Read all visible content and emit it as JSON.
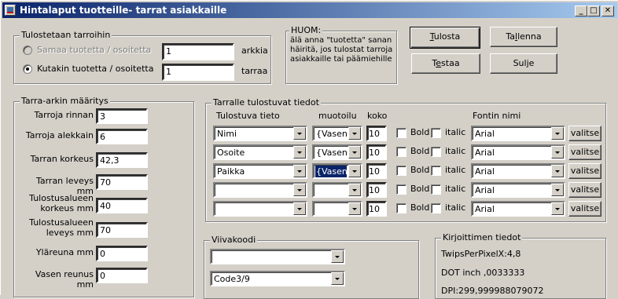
{
  "window": {
    "title": "Hintalaput tuotteille- tarrat asiakkaille",
    "min": "_",
    "max": "□",
    "close": "✕"
  },
  "print_group": {
    "label": "Tulostetaan tarroihin",
    "radio1": "Samaa tuotetta / osoitetta",
    "radio1_selected": false,
    "radio1_disabled": true,
    "radio2": "Kutakin tuotetta / osoitetta",
    "radio2_selected": true,
    "sheets_value": "1",
    "sheets_unit": "arkkia",
    "labels_value": "1",
    "labels_unit": "tarraa"
  },
  "note": {
    "label": "HUOM:",
    "text": "älä anna \"tuotetta\" sanan häiritä, jos tulostat tarroja asiakkaille tai päämiehille"
  },
  "buttons": {
    "print": "Tulosta",
    "print_key": "T",
    "print_rest": "ulosta",
    "save": "Tallenna",
    "save_pre": "Ta",
    "save_key": "l",
    "save_rest": "lenna",
    "test": "Testaa",
    "test_pre": "T",
    "test_key": "e",
    "test_rest": "staa",
    "close": "Sulje",
    "close_pre": "Sul",
    "close_key": "j",
    "close_rest": "e"
  },
  "label_def": {
    "label": "Tarra-arkin määritys",
    "fields": [
      {
        "label": "Tarroja rinnan",
        "value": "3"
      },
      {
        "label": "Tarroja alekkain",
        "value": "6"
      },
      {
        "label": "Tarran korkeus",
        "value": "42,3"
      },
      {
        "label": "Tarran leveys mm",
        "value": "70"
      },
      {
        "label": "Tulostusalueen korkeus mm",
        "value": "40"
      },
      {
        "label": "Tulostusalueen leveys mm",
        "value": "70"
      },
      {
        "label": "Yläreuna mm",
        "value": "0"
      },
      {
        "label": "Vasen reunus mm",
        "value": "0"
      }
    ]
  },
  "fields_group": {
    "label": "Tarralle tulostuvat tiedot",
    "headers": {
      "field": "Tulostuva tieto",
      "format": "muotoilu",
      "size": "koko",
      "font": "Fontin nimi"
    },
    "bold": "Bold",
    "italic": "italic",
    "choose": "valitse",
    "rows": [
      {
        "field": "Nimi",
        "format": "{Vasen",
        "size": "10",
        "font": "Arial",
        "format_selected": false
      },
      {
        "field": "Osoite",
        "format": "{Vasen",
        "size": "10",
        "font": "Arial",
        "format_selected": false
      },
      {
        "field": "Paikka",
        "format": "{Vasen",
        "size": "10",
        "font": "Arial",
        "format_selected": true
      },
      {
        "field": "",
        "format": "",
        "size": "10",
        "font": "Arial",
        "format_selected": false
      },
      {
        "field": "",
        "format": "",
        "size": "10",
        "font": "Arial",
        "format_selected": false
      }
    ]
  },
  "barcode": {
    "label": "Viivakoodi",
    "field": "",
    "type": "Code3/9"
  },
  "printer": {
    "label": "Kirjoittimen tiedot",
    "twips": "TwipsPerPixelX:4,8",
    "dot": "DOT inch ,0033333",
    "dpi": "DPI:299,999988079072"
  },
  "colors": {
    "title_start": "#0a246a",
    "title_end": "#a6caf0",
    "face": "#d4d0c8"
  }
}
